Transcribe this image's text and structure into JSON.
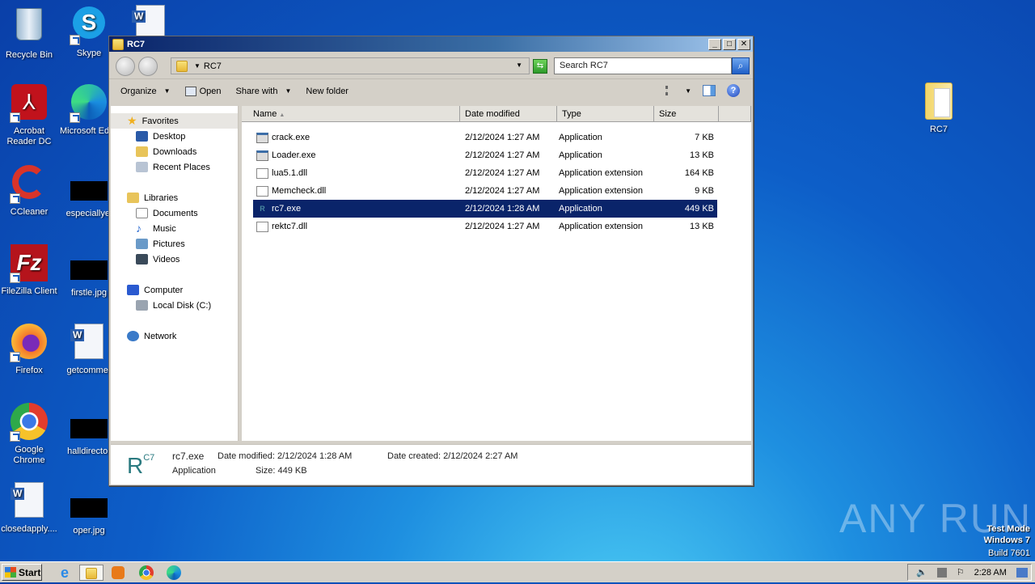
{
  "desktop": {
    "icons": [
      {
        "label": "Recycle Bin",
        "icon": "recycle-bin-icon"
      },
      {
        "label": "Skype",
        "icon": "skype-icon"
      },
      {
        "label": "Acrobat Reader DC",
        "icon": "acrobat-icon"
      },
      {
        "label": "Microsoft Edge",
        "icon": "edge-icon"
      },
      {
        "label": "CCleaner",
        "icon": "ccleaner-icon"
      },
      {
        "label": "especiallyel",
        "icon": "image-thumbnail"
      },
      {
        "label": "FileZilla Client",
        "icon": "filezilla-icon"
      },
      {
        "label": "firstle.jpg",
        "icon": "image-thumbnail"
      },
      {
        "label": "Firefox",
        "icon": "firefox-icon"
      },
      {
        "label": "getcommer",
        "icon": "word-doc-icon"
      },
      {
        "label": "Google Chrome",
        "icon": "chrome-icon"
      },
      {
        "label": "halldirector",
        "icon": "image-thumbnail"
      },
      {
        "label": "closedapply....",
        "icon": "word-doc-icon"
      },
      {
        "label": "oper.jpg",
        "icon": "image-thumbnail"
      },
      {
        "label": "RC7",
        "icon": "folder-icon"
      }
    ],
    "watermark": "ANY RUN",
    "test_mode": [
      "Test Mode",
      "Windows 7",
      "Build 7601"
    ]
  },
  "window": {
    "title": "RC7",
    "controls": {
      "minimize": "_",
      "maximize": "□",
      "close": "✕"
    },
    "address": {
      "path": "RC7"
    },
    "search": {
      "placeholder": "Search RC7"
    },
    "toolbar": {
      "organize": "Organize",
      "open": "Open",
      "share_with": "Share with",
      "new_folder": "New folder"
    },
    "nav": {
      "favorites": {
        "label": "Favorites",
        "items": [
          "Desktop",
          "Downloads",
          "Recent Places"
        ]
      },
      "libraries": {
        "label": "Libraries",
        "items": [
          "Documents",
          "Music",
          "Pictures",
          "Videos"
        ]
      },
      "computer": {
        "label": "Computer",
        "items": [
          "Local Disk (C:)"
        ]
      },
      "network": {
        "label": "Network"
      }
    },
    "columns": [
      "Name",
      "Date modified",
      "Type",
      "Size"
    ],
    "files": [
      {
        "name": "crack.exe",
        "date": "2/12/2024 1:27 AM",
        "type": "Application",
        "size": "7 KB",
        "kind": "exe"
      },
      {
        "name": "Loader.exe",
        "date": "2/12/2024 1:27 AM",
        "type": "Application",
        "size": "13 KB",
        "kind": "exe"
      },
      {
        "name": "lua5.1.dll",
        "date": "2/12/2024 1:27 AM",
        "type": "Application extension",
        "size": "164 KB",
        "kind": "dll"
      },
      {
        "name": "Memcheck.dll",
        "date": "2/12/2024 1:27 AM",
        "type": "Application extension",
        "size": "9 KB",
        "kind": "dll"
      },
      {
        "name": "rc7.exe",
        "date": "2/12/2024 1:28 AM",
        "type": "Application",
        "size": "449 KB",
        "kind": "rc",
        "selected": true
      },
      {
        "name": "rektc7.dll",
        "date": "2/12/2024 1:27 AM",
        "type": "Application extension",
        "size": "13 KB",
        "kind": "dll"
      }
    ],
    "details": {
      "name": "rc7.exe",
      "type": "Application",
      "date_modified": "Date modified: 2/12/2024 1:28 AM",
      "date_created": "Date created: 2/12/2024 2:27 AM",
      "size": "Size: 449 KB",
      "icon_text": "R",
      "icon_sup": "C7"
    }
  },
  "taskbar": {
    "start": "Start",
    "clock": "2:28 AM"
  }
}
